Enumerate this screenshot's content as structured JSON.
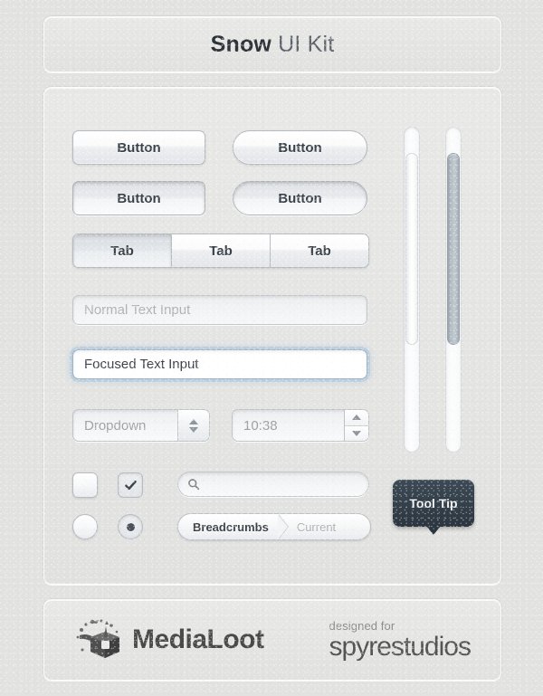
{
  "header": {
    "title_bold": "Snow",
    "title_light": "UI Kit"
  },
  "buttons": [
    {
      "label": "Button",
      "name": "button-normal-rect",
      "state": "normal"
    },
    {
      "label": "Button",
      "name": "button-normal-pill",
      "state": "normal"
    },
    {
      "label": "Button",
      "name": "button-pressed-rect",
      "state": "pressed"
    },
    {
      "label": "Button",
      "name": "button-pressed-pill",
      "state": "pressed"
    }
  ],
  "tabs": [
    {
      "label": "Tab",
      "active": true
    },
    {
      "label": "Tab",
      "active": false
    },
    {
      "label": "Tab",
      "active": false
    }
  ],
  "inputs": {
    "normal": {
      "placeholder": "Normal Text Input",
      "value": ""
    },
    "focused": {
      "placeholder": "",
      "value": "Focused Text Input"
    }
  },
  "dropdown": {
    "value": "Dropdown",
    "up_icon": "triangle-up-icon",
    "down_icon": "triangle-down-icon"
  },
  "timefield": {
    "value": "10:38",
    "up_icon": "stepper-up-icon",
    "down_icon": "stepper-down-icon"
  },
  "controls": {
    "checkbox_unchecked": {
      "checked": false
    },
    "checkbox_checked": {
      "checked": true,
      "icon": "checkmark-icon"
    },
    "radio_unselected": {
      "selected": false
    },
    "radio_selected": {
      "selected": true
    }
  },
  "search": {
    "icon": "search-icon",
    "placeholder": "",
    "value": ""
  },
  "breadcrumbs": {
    "items": [
      {
        "label": "Breadcrumbs",
        "current": false
      },
      {
        "label": "Current",
        "current": true
      }
    ]
  },
  "tooltip": {
    "text": "Tool Tip"
  },
  "scrollbars": [
    {
      "name": "scrollbar-light",
      "thumb_color": "#f4f6f7"
    },
    {
      "name": "scrollbar-dark",
      "thumb_color": "#aab3bd"
    }
  ],
  "footer": {
    "medialoot": {
      "name": "MediaLoot",
      "icon": "treasure-box-icon"
    },
    "spyrestudios": {
      "tagline": "designed for",
      "name": "spyrestudios"
    }
  },
  "colors": {
    "background": "#e2e2e0",
    "panel": "#e5e5e3",
    "text_dark": "#3a4149",
    "text_muted": "#aeb2b6",
    "tooltip_bg": "#2c3640",
    "focus_glow": "#9fb4c7"
  }
}
